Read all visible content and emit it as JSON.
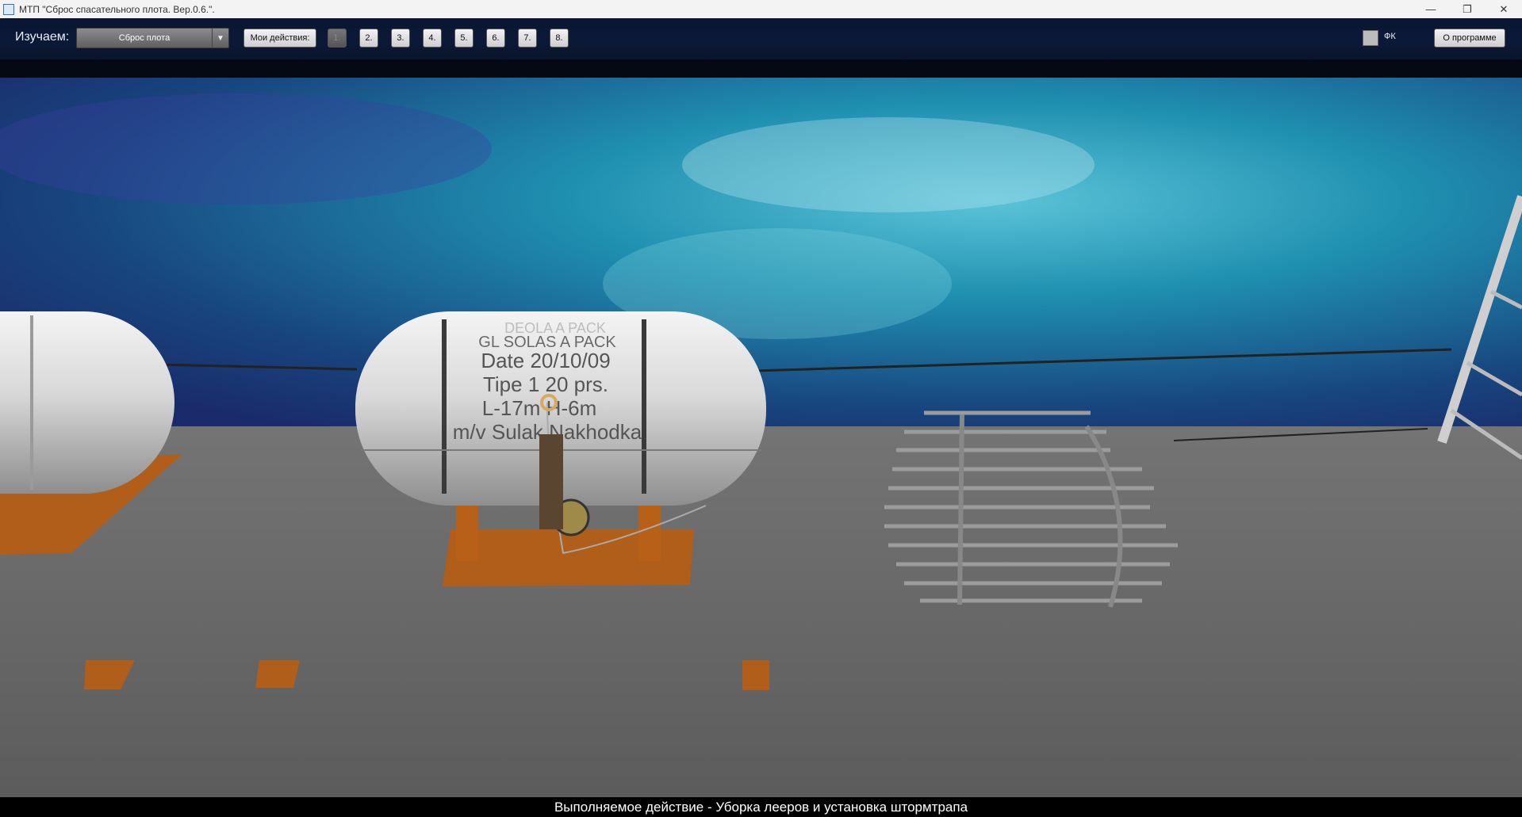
{
  "window": {
    "title": "МТП \"Сброс спасательного плота. Вер.0.6.\".",
    "controls": {
      "minimize": "—",
      "maximize": "❐",
      "close": "✕"
    }
  },
  "toolbar": {
    "study_label": "Изучаем:",
    "study_value": "Сброс плота",
    "combo_arrow": "▼",
    "my_actions_label": "Мои действия:",
    "step_buttons": [
      "1.",
      "2.",
      "3.",
      "4.",
      "5.",
      "6.",
      "7.",
      "8."
    ],
    "fk_label": "ФК",
    "about_label": "О программе"
  },
  "scene": {
    "raft_container_text": [
      "DEOLA A PACK",
      "GL SOLAS A PACK",
      "Date 20/10/09",
      "Tipe 1 20 prs.",
      "L-17m H-6m",
      "m/v Sulak Nakhodka"
    ]
  },
  "status": {
    "text": "Выполняемое действие - Уборка лееров и установка штормтрапа"
  },
  "colors": {
    "toolbar_bg": "#0b1938",
    "deck": "#686868",
    "cradle": "#b05e1a",
    "sea": "#1a7fa0"
  }
}
